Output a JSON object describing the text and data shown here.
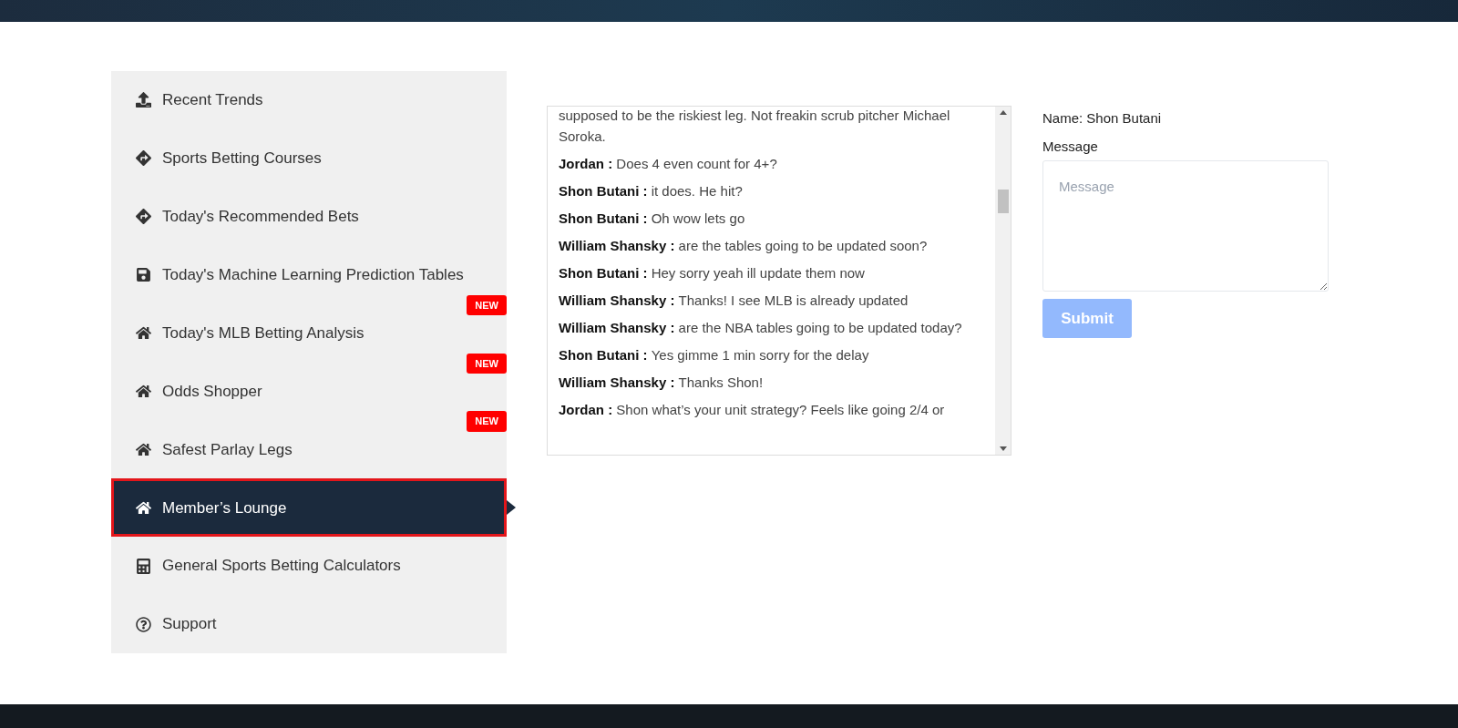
{
  "sidebar": {
    "items": [
      {
        "label": "Recent Trends",
        "kind": "upload",
        "selected": false
      },
      {
        "label": "Sports Betting Courses",
        "kind": "directions",
        "selected": false
      },
      {
        "label": "Today's Recommended Bets",
        "kind": "directions",
        "selected": false
      },
      {
        "label": "Today's Machine Learning Prediction Tables",
        "kind": "save",
        "selected": false
      },
      {
        "label": "Today's MLB Betting Analysis",
        "kind": "home",
        "selected": false,
        "badge": "NEW"
      },
      {
        "label": "Odds Shopper",
        "kind": "home",
        "selected": false,
        "badge": "NEW"
      },
      {
        "label": "Safest Parlay Legs",
        "kind": "home",
        "selected": false,
        "badge": "NEW"
      },
      {
        "label": "Member’s Lounge",
        "kind": "home",
        "selected": true
      },
      {
        "label": "General Sports Betting Calculators",
        "kind": "calculator",
        "selected": false
      },
      {
        "label": "Support",
        "kind": "help",
        "selected": false
      }
    ]
  },
  "chat": {
    "messages": [
      {
        "text": "supposed to be the riskiest leg. Not freakin scrub pitcher Michael Soroka."
      },
      {
        "author": "Jordan :",
        "text": "Does 4 even count for 4+?"
      },
      {
        "author": "Shon Butani :",
        "text": "it does. He hit?"
      },
      {
        "author": "Shon Butani :",
        "text": "Oh wow lets go"
      },
      {
        "author": "William Shansky :",
        "text": "are the tables going to be updated soon?"
      },
      {
        "author": "Shon Butani :",
        "text": "Hey sorry yeah ill update them now"
      },
      {
        "author": "William Shansky :",
        "text": "Thanks! I see MLB is already updated"
      },
      {
        "author": "William Shansky :",
        "text": "are the NBA tables going to be updated today?"
      },
      {
        "author": "Shon Butani :",
        "text": "Yes gimme 1 min sorry for the delay"
      },
      {
        "author": "William Shansky :",
        "text": "Thanks Shon!"
      },
      {
        "author": "Jordan :",
        "text": "Shon what’s your unit strategy? Feels like going 2/4 or"
      }
    ]
  },
  "form": {
    "name": "Name: Shon Butani",
    "message_label": "Message",
    "message": {
      "placeholder": "Message"
    },
    "submit": {
      "label": "Submit",
      "disabled": true
    }
  }
}
